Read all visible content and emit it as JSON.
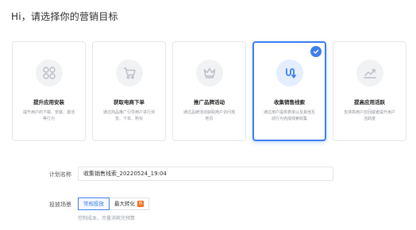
{
  "page": {
    "title": "Hi，请选择你的营销目标"
  },
  "cards": [
    {
      "title": "提升应用安装",
      "desc": "提升用户的下载、安装、激活等行为",
      "icon": "grid-apps-icon"
    },
    {
      "title": "获取电商下单",
      "desc": "通过商品推广引导用户进行浏览、下单、购买",
      "icon": "shopping-cart-icon"
    },
    {
      "title": "推广品牌活动",
      "desc": "通过品牌活动获取用户访问落地页",
      "icon": "crown-icon"
    },
    {
      "title": "收集销售线索",
      "desc": "通过用户提供表单以及其他互动行为完成线索收集",
      "icon": "magnet-icon",
      "selected": true
    },
    {
      "title": "提高应用活跃",
      "desc": "支持高用户召回或者提升用户活跃度",
      "icon": "trend-up-icon"
    }
  ],
  "form": {
    "plan_name_label": "计划名称",
    "plan_name_value": "收集销售线索_20220524_19:04",
    "scene_label": "投放场景",
    "scene_options": [
      "常规投放",
      "最大转化"
    ],
    "scene_selected": "常规投放",
    "hot_badge": "热",
    "scene_hint": "控制成本，尽量消耗完预算"
  },
  "colors": {
    "accent": "#3d7ef0",
    "hot": "#f26a1b",
    "icon_gray": "#c3c6cc"
  }
}
